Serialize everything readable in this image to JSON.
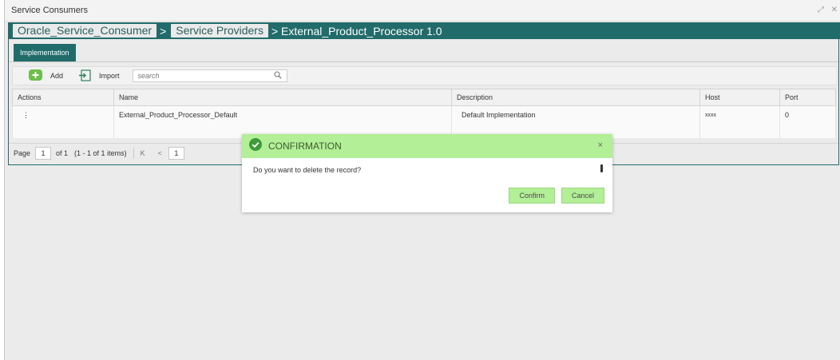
{
  "window": {
    "title": "Service Consumers",
    "controls": [
      "⤢",
      "✕"
    ]
  },
  "breadcrumb": {
    "item1": "Oracle_Service_Consumer",
    "sep": ">",
    "item2": "Service Providers",
    "current": "> External_Product_Processor 1.0"
  },
  "tabs": [
    {
      "label": "Implementation"
    }
  ],
  "toolbar": {
    "add_label": "Add",
    "import_label": "Import",
    "search_placeholder": "search"
  },
  "table": {
    "columns": [
      "Actions",
      "Name",
      "Description",
      "Host",
      "Port"
    ],
    "rows": [
      {
        "actions": "⋮",
        "name": "External_Product_Processor_Default",
        "description": "Default Implementation",
        "host": "xxxx",
        "port": "0"
      }
    ]
  },
  "pager": {
    "page_label": "Page",
    "page_value": "1",
    "of_label": "of 1",
    "items_label": "(1 - 1 of 1 items)",
    "first": "K",
    "prev": "<",
    "current": "1"
  },
  "dialog": {
    "title": "CONFIRMATION",
    "close": "×",
    "message": "Do you want to delete the record?",
    "confirm_label": "Confirm",
    "cancel_label": "Cancel"
  },
  "colors": {
    "teal": "#226b6b",
    "green": "#b2ef96",
    "add_icon": "#6cbf4a"
  }
}
